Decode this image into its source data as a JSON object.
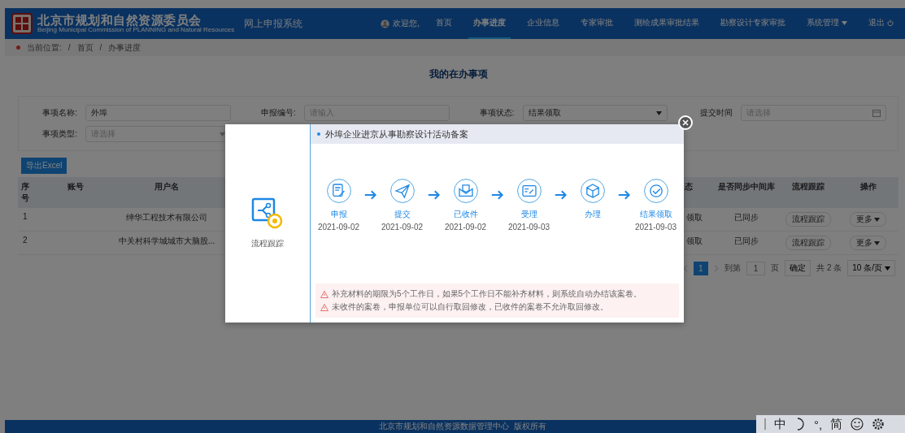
{
  "header": {
    "logo_title": "北京市规划和自然资源委员会",
    "logo_subtitle": "Beijing Municipal Commission of PLANNING and Natural Resources",
    "system_name": "网上申报系统",
    "welcome": "欢迎您,",
    "nav": [
      {
        "label": "首页",
        "selected": false,
        "kind": "link"
      },
      {
        "label": "办事进度",
        "selected": true,
        "kind": "link"
      },
      {
        "label": "企业信息",
        "selected": false,
        "kind": "link"
      },
      {
        "label": "专家审批",
        "selected": false,
        "kind": "link"
      },
      {
        "label": "测绘成果审批结果",
        "selected": false,
        "kind": "link"
      },
      {
        "label": "勘察设计专家审批",
        "selected": false,
        "kind": "link"
      },
      {
        "label": "系统管理",
        "selected": false,
        "kind": "dropdown"
      },
      {
        "label": "退出",
        "selected": false,
        "kind": "logout"
      }
    ]
  },
  "breadcrumb": {
    "label": "当前位置:",
    "items": [
      {
        "separator": "/",
        "label": "首页"
      },
      {
        "separator": "/",
        "label": "办事进度"
      }
    ]
  },
  "page_title": "我的在办事项",
  "filters": [
    {
      "label": "事项名称:",
      "value": "外埠",
      "kind": "text"
    },
    {
      "label": "申报编号:",
      "placeholder": "请输入",
      "kind": "text"
    },
    {
      "label": "事项状态:",
      "value": "结果领取",
      "kind": "select"
    },
    {
      "label": "提交时间",
      "placeholder": "请选择",
      "kind": "date"
    },
    {
      "label": "事项类型:",
      "placeholder": "请选择",
      "kind": "select"
    }
  ],
  "export_button": "导出Excel",
  "table": {
    "columns": [
      "序号",
      "账号",
      "用户名",
      "",
      "态",
      "是否同步中间库",
      "流程跟踪",
      "操作"
    ],
    "rows": [
      {
        "cells": [
          "1",
          "",
          "绅华工程技术有限公司",
          "",
          "领取",
          "已同步"
        ],
        "trace": "流程跟踪",
        "more": "更多"
      },
      {
        "cells": [
          "2",
          "",
          "中关村科学城城市大脑股...",
          "",
          "领取",
          "已同步"
        ],
        "trace": "流程跟踪",
        "more": "更多"
      }
    ]
  },
  "pagination": {
    "pages": [
      {
        "label": "1",
        "selected": true
      }
    ],
    "goto": "到第",
    "page_input": "1",
    "page_unit": "页",
    "confirm": "确定",
    "total": "共 2 条",
    "page_size": "10 条/页"
  },
  "modal": {
    "side_label": "流程跟踪",
    "title": "外埠企业进京从事勘察设计活动备案",
    "steps": [
      {
        "label": "申报",
        "date": "2021-09-02"
      },
      {
        "label": "提交",
        "date": "2021-09-02"
      },
      {
        "label": "已收件",
        "date": "2021-09-02"
      },
      {
        "label": "受理",
        "date": "2021-09-03"
      },
      {
        "label": "办理"
      },
      {
        "label": "结果领取",
        "date": "2021-09-03"
      }
    ],
    "notices": [
      "补充材料的期限为5个工作日，如果5个工作日不能补齐材料，则系统自动办结该案卷。",
      "未收件的案卷，申报单位可以自行取回修改，已收件的案卷不允许取回修改。"
    ]
  },
  "footer": "北京市规划和自然资源数据管理中心  版权所有",
  "ime_toolbar": [
    "中",
    "°,",
    "简"
  ]
}
